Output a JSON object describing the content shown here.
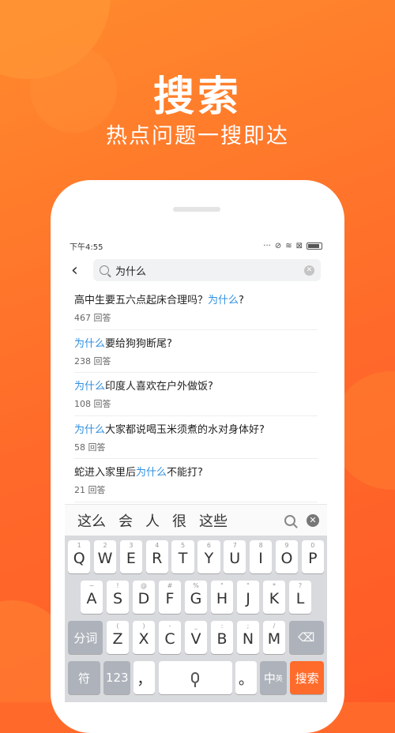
{
  "hero": {
    "title": "搜索",
    "subtitle": "热点问题一搜即达"
  },
  "status": {
    "time": "下午4:55"
  },
  "search": {
    "query": "为什么",
    "back_icon": "back-arrow-icon"
  },
  "results": [
    {
      "pre": "高中生要五六点起床合理吗？",
      "hl": "为什么",
      "post": "?",
      "answers": "467 回答"
    },
    {
      "pre": "",
      "hl": "为什么",
      "post": "要给狗狗断尾?",
      "answers": "238 回答"
    },
    {
      "pre": "",
      "hl": "为什么",
      "post": "印度人喜欢在户外做饭?",
      "answers": "108 回答"
    },
    {
      "pre": "",
      "hl": "为什么",
      "post": "大家都说喝玉米须煮的水对身体好?",
      "answers": "58 回答"
    },
    {
      "pre": "蛇进入家里后",
      "hl": "为什么",
      "post": "不能打?",
      "answers": "21 回答"
    }
  ],
  "candidates": [
    "这么",
    "会",
    "人",
    "很",
    "这些"
  ],
  "keyboard": {
    "row1": [
      {
        "k": "Q",
        "h": "1"
      },
      {
        "k": "W",
        "h": "2"
      },
      {
        "k": "E",
        "h": "3"
      },
      {
        "k": "R",
        "h": "4"
      },
      {
        "k": "T",
        "h": "5"
      },
      {
        "k": "Y",
        "h": "6"
      },
      {
        "k": "U",
        "h": "7"
      },
      {
        "k": "I",
        "h": "8"
      },
      {
        "k": "O",
        "h": "9"
      },
      {
        "k": "P",
        "h": "0"
      }
    ],
    "row2": [
      {
        "k": "A",
        "h": "~"
      },
      {
        "k": "S",
        "h": "!"
      },
      {
        "k": "D",
        "h": "@"
      },
      {
        "k": "F",
        "h": "#"
      },
      {
        "k": "G",
        "h": "%"
      },
      {
        "k": "H",
        "h": "\""
      },
      {
        "k": "J",
        "h": "\""
      },
      {
        "k": "K",
        "h": "*"
      },
      {
        "k": "L",
        "h": "?"
      }
    ],
    "row3": [
      {
        "k": "Z",
        "h": "("
      },
      {
        "k": "X",
        "h": ")"
      },
      {
        "k": "C",
        "h": "-"
      },
      {
        "k": "V",
        "h": "_"
      },
      {
        "k": "B",
        "h": ":"
      },
      {
        "k": "N",
        "h": ";"
      },
      {
        "k": "M",
        "h": "/"
      }
    ],
    "fenci": "分词",
    "fu": "符",
    "num": "123",
    "comma": "，",
    "period": "。",
    "zh": "中",
    "en": "英",
    "search": "搜索"
  }
}
